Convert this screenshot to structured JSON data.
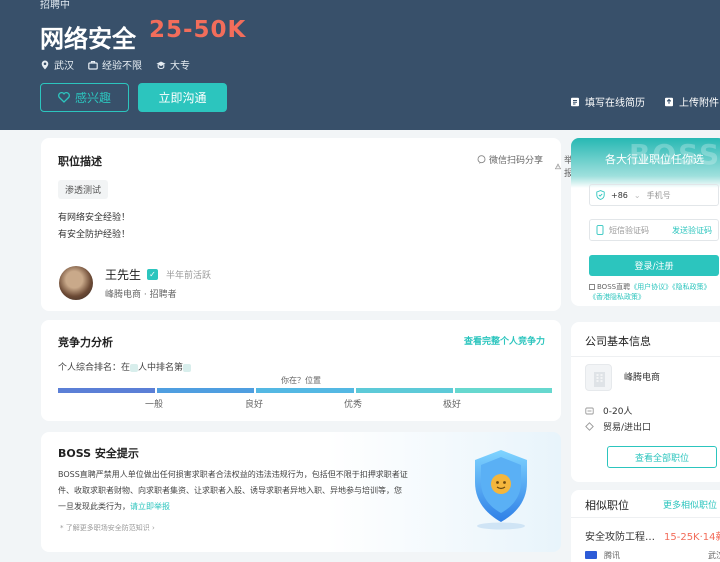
{
  "header": {
    "hiring_status": "招聘中",
    "job_title": "网络安全",
    "salary": "25-50K",
    "city": "武汉",
    "experience": "经验不限",
    "education": "大专",
    "interest_label": "感兴趣",
    "chat_label": "立即沟通",
    "resume_label": "填写在线简历",
    "upload_label": "上传附件"
  },
  "description": {
    "title": "职位描述",
    "share_label": "微信扫码分享",
    "report_label": "举报",
    "tag": "渗透测试",
    "lines": [
      "有网络安全经验！",
      "有安全防护经验！"
    ],
    "recruiter_name": "王先生",
    "recruiter_active": "半年前活跃",
    "recruiter_company": "峰腾电商 · 招聘者"
  },
  "competitiveness": {
    "title": "竞争力分析",
    "link": "查看完整个人竞争力",
    "rank_prefix": "个人综合排名：在",
    "rank_mid": "人中排名第",
    "you_here": "你在？位置",
    "levels": [
      "一般",
      "良好",
      "优秀",
      "极好"
    ],
    "colors": [
      "#5b7fd6",
      "#4f9ee0",
      "#54b8e3",
      "#5dcad8",
      "#67d8cf"
    ]
  },
  "safety": {
    "title": "BOSS 安全提示",
    "text": "BOSS直聘严禁用人单位做出任何损害求职者合法权益的违法违规行为，包括但不限于扣押求职者证件、收取求职者财物、向求职者集资、让求职者入股、诱导求职者异地入职、异地参与培训等，您一旦发现此类行为，",
    "report_link": "请立即举报",
    "note": "* 了解更多职场安全防范知识 ›"
  },
  "login": {
    "bg_text": "BOSS",
    "title": "各大行业职位任你选",
    "country_code": "+86",
    "phone_placeholder": "手机号",
    "code_placeholder": "短信验证码",
    "send_code": "发送验证码",
    "submit": "登录/注册",
    "agree_prefix": "BOSS直聘",
    "agree_link1": "《用户协议》",
    "agree_link2": "《隐私政策》",
    "agree_link3": "《香港隐私政策》"
  },
  "company": {
    "title": "公司基本信息",
    "name": "峰腾电商",
    "size": "0-20人",
    "industry": "贸易/进出口",
    "all_jobs": "查看全部职位"
  },
  "similar": {
    "title": "相似职位",
    "more": "更多相似职位",
    "job_title": "安全攻防工程…",
    "job_salary": "15-25K·14薪",
    "job_company": "腾讯",
    "job_city": "武汉"
  }
}
